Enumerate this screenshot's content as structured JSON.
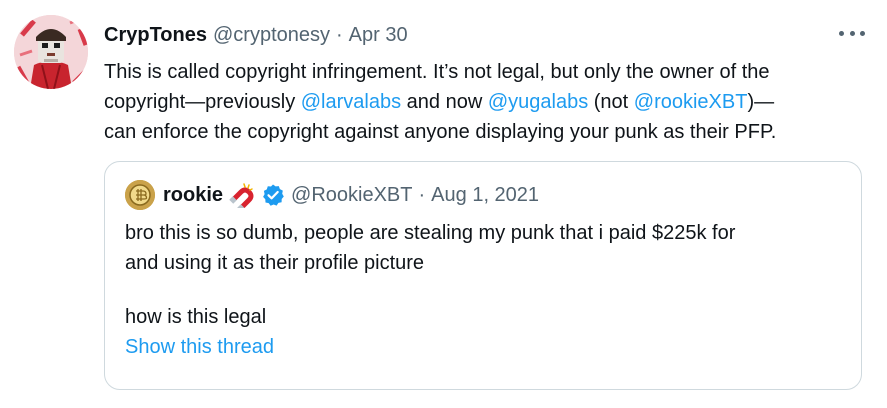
{
  "tweet": {
    "display_name": "CrypTones",
    "handle": "@cryptonesy",
    "separator": "·",
    "date": "Apr 30",
    "body": {
      "line1": "This is called copyright infringement. It’s not legal, but only the owner of the",
      "line2_a": "copyright—previously ",
      "line2_mention1": "@larvalabs",
      "line2_b": " and now ",
      "line2_mention2": "@yugalabs",
      "line2_c": " (not ",
      "line2_mention3": "@rookieXBT",
      "line2_d": ")—",
      "line3": "can enforce the copyright against anyone displaying your punk as their PFP."
    }
  },
  "quote": {
    "display_name": "rookie",
    "handle": "@RookieXBT",
    "separator": "·",
    "date": "Aug 1, 2021",
    "text_line1": "bro this is so dumb, people are stealing my punk that i paid $225k for",
    "text_line2": "and using it as their profile picture",
    "text_line3": "how is this legal",
    "show_thread": "Show this thread"
  },
  "icons": {
    "more": "more-horizontal-icon",
    "magnet": "magnet-icon",
    "verified": "verified-badge-icon"
  },
  "colors": {
    "text": "#0f1419",
    "muted": "#536471",
    "link": "#1d9bf0",
    "border": "#cfd9de"
  }
}
